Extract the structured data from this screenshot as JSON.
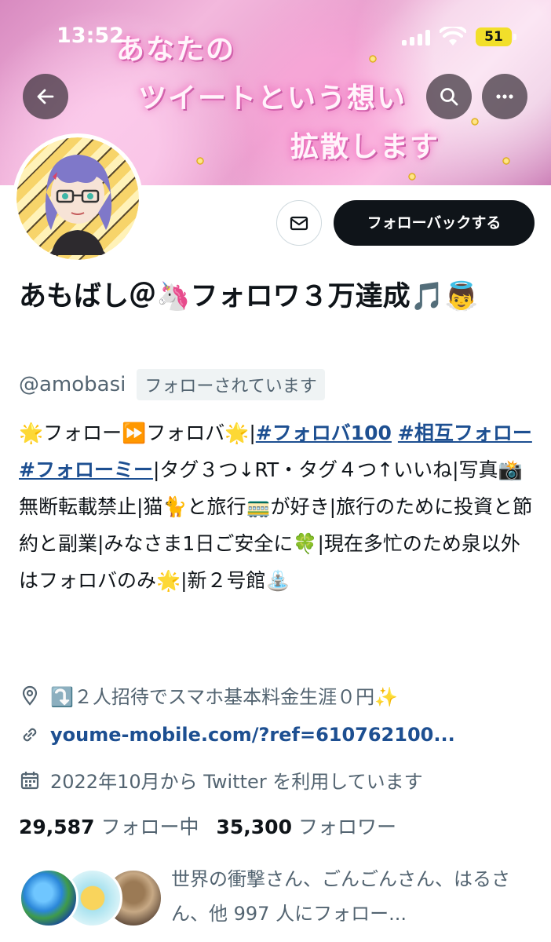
{
  "status_bar": {
    "time": "13:52",
    "battery": "51"
  },
  "banner": {
    "line1": "あなたの",
    "line2": "ツイートという想い",
    "line3": "拡散します"
  },
  "profile": {
    "follow_back_label": "フォローバックする",
    "display_name": "あもばし＠🦄フォロワ３万達成🎵👼",
    "handle": "@amobasi",
    "follows_you": "フォローされています"
  },
  "bio": {
    "part1": "🌟フォロー⏩フォロバ🌟|",
    "tag1": "#フォロバ100",
    "sp1": " ",
    "tag2": "#相互フォロー",
    "sp2": " ",
    "tag3": "#フォローミー",
    "part2": "|タグ３つ↓RT・タグ４つ↑いいね|写真📸無断転載禁止|猫🐈と旅行🚃が好き|旅行のために投資と節約と副業|みなさま1日ご安全に🍀|現在多忙のため泉以外はフォロバのみ🌟|新２号館⛲"
  },
  "meta": {
    "location": "⤵️２人招待でスマホ基本料金生涯０円✨",
    "link": "youme-mobile.com/?ref=610762100...",
    "joined": "2022年10月から Twitter を利用しています"
  },
  "stats": {
    "following_count": "29,587",
    "following_label": "フォロー中",
    "followers_count": "35,300",
    "followers_label": "フォロワー"
  },
  "followers_you_know": {
    "text": "世界の衝撃さん、ごんごんさん、はるさん、他 997 人にフォロー..."
  },
  "colors": {
    "accent_link": "#1d4f91",
    "button_dark": "#0f1419",
    "battery": "#f2df2a",
    "secondary_text": "#536471"
  }
}
